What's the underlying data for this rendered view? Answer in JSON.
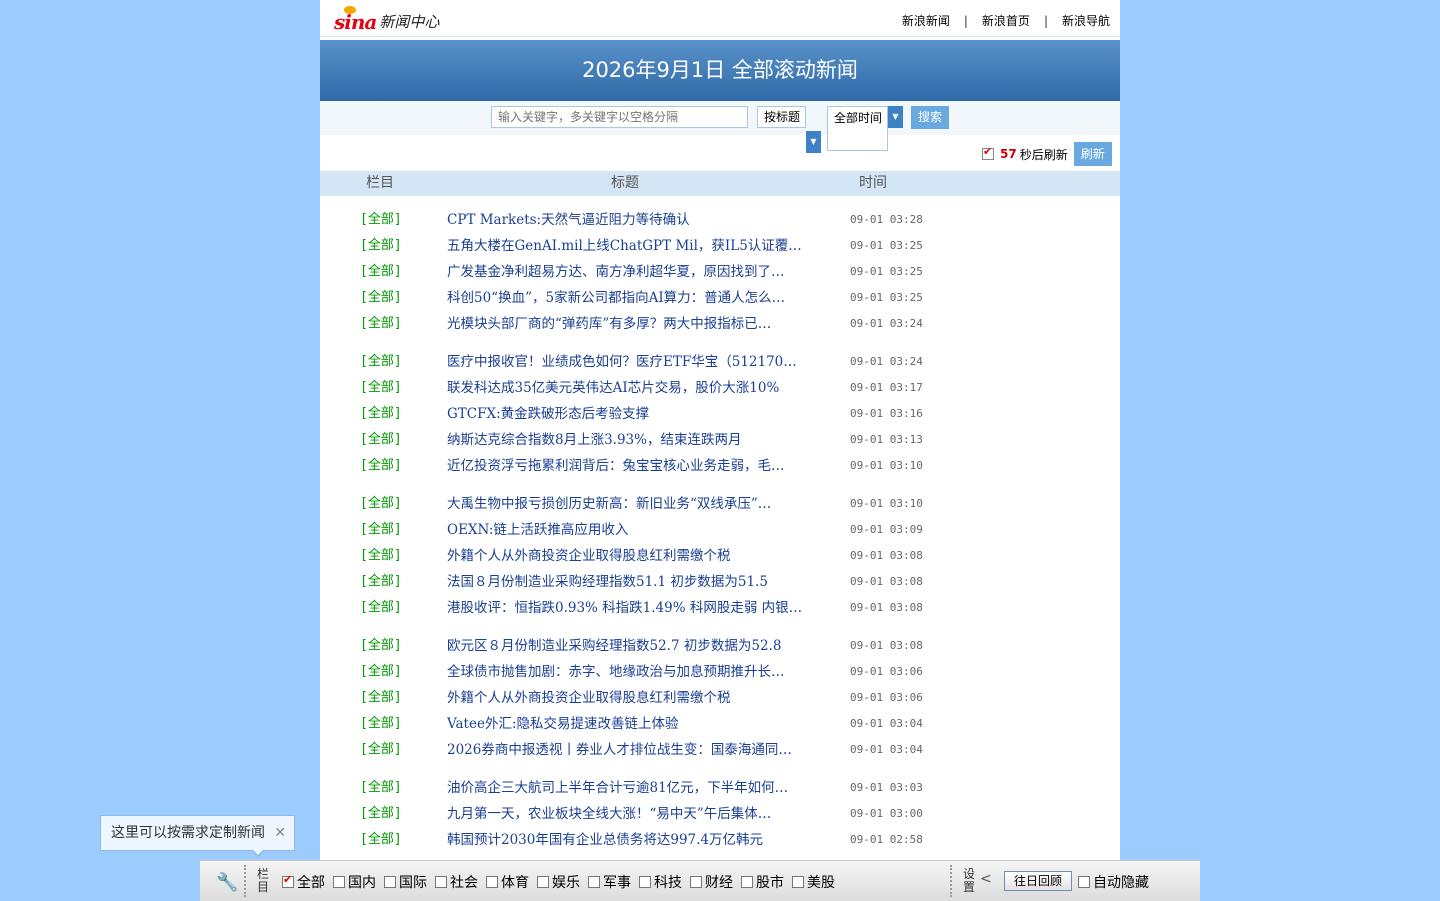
{
  "header": {
    "logo_text": "sina",
    "logo_suffix": "新闻中心",
    "nav": [
      "新浪新闻",
      "新浪首页",
      "新浪导航"
    ],
    "nav_separator": "|"
  },
  "banner": {
    "title": "2026年9月1日 全部滚动新闻"
  },
  "search": {
    "placeholder": "输入关键字，多关键字以空格分隔",
    "by_label": "按标题",
    "time_label": "全部时间",
    "search_button": "搜索",
    "refresh_count": "57",
    "refresh_suffix": "秒后刷新",
    "refresh_button": "刷新"
  },
  "table_header": {
    "column": "栏目",
    "title": "标题",
    "time": "时间"
  },
  "news_groups": [
    [
      {
        "column": "[全部]",
        "title": "CPT Markets:天然气逼近阻力等待确认",
        "time": "09-01 03:28"
      },
      {
        "column": "[全部]",
        "title": "五角大楼在GenAI.mil上线ChatGPT Mil，获IL5认证覆盖…",
        "time": "09-01 03:25"
      },
      {
        "column": "[全部]",
        "title": "广发基金净利超易方达、南方净利超华夏，原因找到了…",
        "time": "09-01 03:25"
      },
      {
        "column": "[全部]",
        "title": "科创50“换血”，5家新公司都指向AI算力：普通人怎么…",
        "time": "09-01 03:25"
      },
      {
        "column": "[全部]",
        "title": "光模块头部厂商的“弹药库”有多厚？两大中报指标已…",
        "time": "09-01 03:24"
      }
    ],
    [
      {
        "column": "[全部]",
        "title": "医疗中报收官！业绩成色如何？医疗ETF华宝（512170）…",
        "time": "09-01 03:24"
      },
      {
        "column": "[全部]",
        "title": "联发科达成35亿美元英伟达AI芯片交易，股价大涨10%",
        "time": "09-01 03:17"
      },
      {
        "column": "[全部]",
        "title": "GTCFX:黄金跌破形态后考验支撑",
        "time": "09-01 03:16"
      },
      {
        "column": "[全部]",
        "title": "纳斯达克综合指数8月上涨3.93%，结束连跌两月",
        "time": "09-01 03:13"
      },
      {
        "column": "[全部]",
        "title": "近亿投资浮亏拖累利润背后：兔宝宝核心业务走弱，毛…",
        "time": "09-01 03:10"
      }
    ],
    [
      {
        "column": "[全部]",
        "title": "大禹生物中报亏损创历史新高：新旧业务“双线承压”…",
        "time": "09-01 03:10"
      },
      {
        "column": "[全部]",
        "title": "OEXN:链上活跃推高应用收入",
        "time": "09-01 03:09"
      },
      {
        "column": "[全部]",
        "title": "外籍个人从外商投资企业取得股息红利需缴个税",
        "time": "09-01 03:08"
      },
      {
        "column": "[全部]",
        "title": "法国８月份制造业采购经理指数51.1 初步数据为51.5",
        "time": "09-01 03:08"
      },
      {
        "column": "[全部]",
        "title": "港股收评：恒指跌0.93% 科指跌1.49% 科网股走弱 内银…",
        "time": "09-01 03:08"
      }
    ],
    [
      {
        "column": "[全部]",
        "title": "欧元区８月份制造业采购经理指数52.7 初步数据为52.8",
        "time": "09-01 03:08"
      },
      {
        "column": "[全部]",
        "title": "全球债市抛售加剧：赤字、地缘政治与加息预期推升长…",
        "time": "09-01 03:06"
      },
      {
        "column": "[全部]",
        "title": "外籍个人从外商投资企业取得股息红利需缴个税",
        "time": "09-01 03:06"
      },
      {
        "column": "[全部]",
        "title": "Vatee外汇:隐私交易提速改善链上体验",
        "time": "09-01 03:04"
      },
      {
        "column": "[全部]",
        "title": "2026券商中报透视丨券业人才排位战生变：国泰海通同…",
        "time": "09-01 03:04"
      }
    ],
    [
      {
        "column": "[全部]",
        "title": "油价高企三大航司上半年合计亏逾81亿元，下半年如何…",
        "time": "09-01 03:03"
      },
      {
        "column": "[全部]",
        "title": "九月第一天，农业板块全线大涨！“易中天”午后集体…",
        "time": "09-01 03:00"
      },
      {
        "column": "[全部]",
        "title": "韩国预计2030年国有企业总债务将达997.4万亿韩元",
        "time": "09-01 02:58"
      }
    ]
  ],
  "tooltip": {
    "text": "这里可以按需求定制新闻",
    "close": "✕"
  },
  "bottombar": {
    "section_label": "栏目",
    "categories": [
      {
        "label": "全部",
        "checked": true
      },
      {
        "label": "国内",
        "checked": false
      },
      {
        "label": "国际",
        "checked": false
      },
      {
        "label": "社会",
        "checked": false
      },
      {
        "label": "体育",
        "checked": false
      },
      {
        "label": "娱乐",
        "checked": false
      },
      {
        "label": "军事",
        "checked": false
      },
      {
        "label": "科技",
        "checked": false
      },
      {
        "label": "财经",
        "checked": false
      },
      {
        "label": "股市",
        "checked": false
      },
      {
        "label": "美股",
        "checked": false
      }
    ],
    "settings_label": "设置",
    "history_button": "往日回顾",
    "autohide_label": "自动隐藏"
  },
  "colors": {
    "background": "#9ccbff",
    "banner": "#3f78b5",
    "column_text": "#009900",
    "title_text": "#1a3f94",
    "button": "#6aa9e0"
  }
}
